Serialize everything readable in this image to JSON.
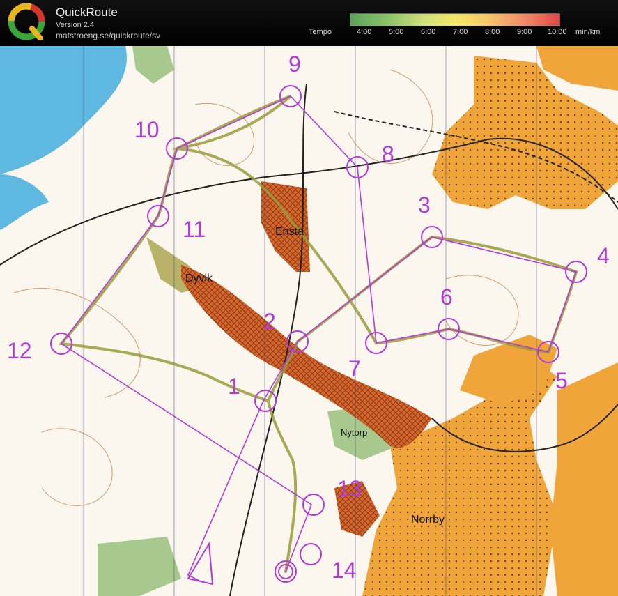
{
  "app": {
    "name": "QuickRoute",
    "version": "Version 2.4",
    "url": "matstroeng.se/quickroute/sv"
  },
  "tempo": {
    "label": "Tempo",
    "ticks": [
      "4:00",
      "5:00",
      "6:00",
      "7:00",
      "8:00",
      "9:00",
      "10:00"
    ],
    "unit": "min/km",
    "colors": [
      "#5aa35a",
      "#cfe07a",
      "#f2e86a",
      "#f5c86a",
      "#e04848"
    ]
  },
  "map": {
    "places": [
      "Ensta",
      "Dyvik",
      "Nytorp",
      "Norrby"
    ],
    "controls": [
      "1",
      "2",
      "3",
      "4",
      "5",
      "6",
      "7",
      "8",
      "9",
      "10",
      "11",
      "12",
      "13",
      "14"
    ],
    "course_color": "#b23bd6"
  }
}
